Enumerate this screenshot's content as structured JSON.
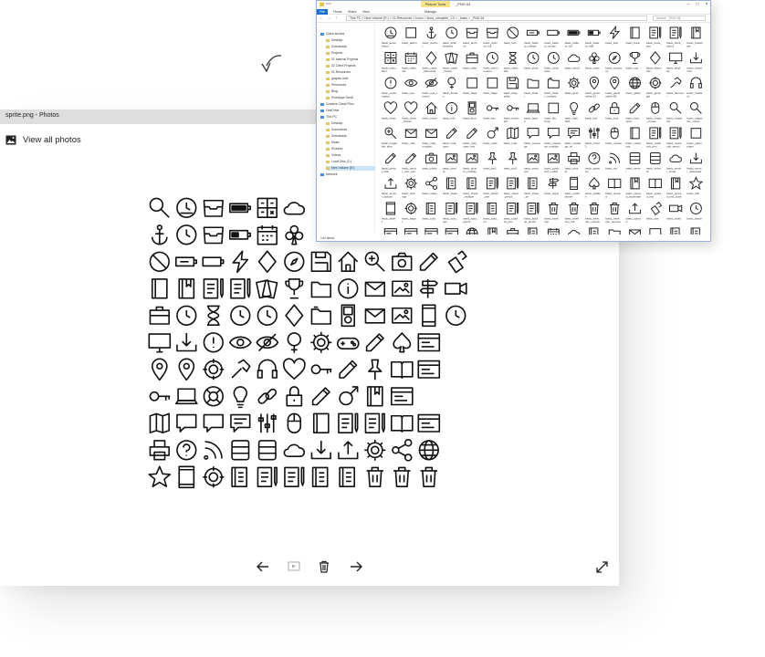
{
  "photos": {
    "title": "sprite.png - Photos",
    "view_all": "View all photos",
    "toolbar": {
      "prev": "arrow-left-icon",
      "slideshow": "slideshow-icon",
      "delete": "trash-icon",
      "next": "arrow-right-icon",
      "fullscreen": "fullscreen-icon"
    }
  },
  "explorer": {
    "title": "_PNG 64",
    "context_tab": "Picture Tools",
    "ribbon_tabs": [
      "File",
      "Home",
      "Share",
      "View",
      "Manage"
    ],
    "address": "This PC  >  New Volume (E:)  >  01 Resources  >  Icons  >  linea_complete_1.0  >  _basic  >  _PNG 64",
    "search_placeholder": "Search _PNG 64",
    "status": "144 items",
    "nav": [
      {
        "label": "Quick access",
        "level": 0
      },
      {
        "label": "Desktop",
        "level": 1
      },
      {
        "label": "Downloads",
        "level": 1
      },
      {
        "label": "Projects",
        "level": 1
      },
      {
        "label": "01 Internal Projects",
        "level": 1
      },
      {
        "label": "02 Client Projects",
        "level": 1
      },
      {
        "label": "01 Resources",
        "level": 1
      },
      {
        "label": "graphic river",
        "level": 1
      },
      {
        "label": "Resources",
        "level": 1
      },
      {
        "label": "Blog",
        "level": 1
      },
      {
        "label": "Prototype Scroll",
        "level": 1
      },
      {
        "label": "Creative Cloud Files",
        "level": 0
      },
      {
        "label": "OneDrive",
        "level": 0
      },
      {
        "label": "This PC",
        "level": 0
      },
      {
        "label": "Desktop",
        "level": 1
      },
      {
        "label": "Documents",
        "level": 1
      },
      {
        "label": "Downloads",
        "level": 1
      },
      {
        "label": "Music",
        "level": 1
      },
      {
        "label": "Pictures",
        "level": 1
      },
      {
        "label": "Videos",
        "level": 1
      },
      {
        "label": "Local Disk (C:)",
        "level": 1
      },
      {
        "label": "New Volume (E:)",
        "level": 1
      },
      {
        "label": "Network",
        "level": 0
      }
    ],
    "files": [
      "basic_accelerator",
      "basic_alarm",
      "basic_anchor",
      "basic_anticlockwise",
      "basic_archive",
      "basic_archive_full",
      "basic_ban",
      "basic_battery_charge",
      "basic_battery_empty",
      "basic_battery_full",
      "basic_battery_half",
      "basic_bolt",
      "basic_book",
      "basic_book_pen",
      "basic_book_pencil",
      "basic_bookmark",
      "basic_calculator",
      "basic_calendar",
      "basic_cards_diamonds",
      "basic_cards_hearts",
      "basic_case",
      "basic_chronometer",
      "basic_clessidre",
      "basic_clock",
      "basic_clockwise",
      "basic_cloud",
      "basic_clubs",
      "basic_compass",
      "basic_cup",
      "basic_diamonds",
      "basic_display",
      "basic_download",
      "basic_exclamation",
      "basic_eye",
      "basic_eye_closed",
      "basic_female",
      "basic_flag1",
      "basic_flag2",
      "basic_floppydisk",
      "basic_folder",
      "basic_folder_multiple",
      "basic_gear",
      "basic_geolocalize-01",
      "basic_geolocalize-05",
      "basic_globe",
      "basic_gunsight",
      "basic_hammer",
      "basic_headset",
      "basic_heart",
      "basic_heart_broken",
      "basic_home",
      "basic_info",
      "basic_ipod",
      "basic_key",
      "basic_keyboard",
      "basic_laptop",
      "basic_life_buoy",
      "basic_lightbulb",
      "basic_link",
      "basic_lock",
      "basic_lock_open",
      "basic_magic_mouse",
      "basic_magnifier",
      "basic_magnifier_minus",
      "basic_magnifier_plus",
      "basic_mail",
      "basic_mail_multiple",
      "basic_mail_open",
      "basic_mail_open_text",
      "basic_male",
      "basic_map",
      "basic_message",
      "basic_message_multiple",
      "basic_message_txt",
      "basic_mixer2",
      "basic_mouse",
      "basic_notebook",
      "basic_notebook_pen",
      "basic_notebook_pencil",
      "basic_paperplane",
      "basic_pencil_ruler",
      "basic_pencil_ruler_pen",
      "basic_photo",
      "basic_picture",
      "basic_picture_multiple",
      "basic_pin1",
      "basic_pin2",
      "basic_postcard",
      "basic_postcard_multiple",
      "basic_printer",
      "basic_question",
      "basic_rss",
      "basic_server",
      "basic_server2",
      "basic_server_cloud",
      "basic_server_download",
      "basic_server_upload",
      "basic_settings",
      "basic_share",
      "basic_sheet",
      "basic_sheet_multiple",
      "basic_sheet_pen",
      "basic_sheet_pencil",
      "basic_sheet_txt",
      "basic_signs",
      "basic_smartphone",
      "basic_spades",
      "basic_spread",
      "basic_spread_bookmark",
      "basic_spread_text",
      "basic_spread_text_bookmark",
      "basic_star",
      "basic_tablet",
      "basic_target",
      "basic_todo",
      "basic_todo_pen",
      "basic_todo_pencil",
      "basic_todo_txt",
      "basic_todolist_pen",
      "basic_todolist_pencil",
      "basic_trashcan",
      "basic_trashcan_full",
      "basic_trashcan_refresh",
      "basic_trashcan_remove",
      "basic_upload",
      "basic_usb",
      "basic_video",
      "basic_watch",
      "basic_webpage",
      "basic_webpage_img_txt",
      "basic_webpage_multiple",
      "basic_webpage_txt",
      "basic_world",
      "basic_elaboration_bookmark",
      "basic_elaboration_briefcase",
      "basic_elaboration_browser",
      "basic_elaboration_calendar",
      "basic_elaboration_cloud",
      "basic_elaboration_document",
      "basic_elaboration_folder",
      "basic_elaboration_mail",
      "basic_elaboration_message",
      "basic_elaboration_printer",
      "basic_elaboration_todo"
    ]
  },
  "sprite": {
    "rows": [
      [
        "magnifier",
        "accelerator",
        "archive",
        "battery-full",
        "calculator",
        "cloud"
      ],
      [
        "anchor",
        "clock",
        "archive-full",
        "battery-half",
        "calendar",
        "clubs"
      ],
      [
        "ban",
        "battery-charge",
        "battery-empty",
        "bolt",
        "cards-diamonds",
        "compass",
        "floppydisk",
        "home",
        "magnifier-plus",
        "photo",
        "pencil",
        "usb"
      ],
      [
        "book",
        "bookmark",
        "book-pen",
        "book-pencil",
        "cards-hearts",
        "cup",
        "folder",
        "info",
        "mail",
        "postcard",
        "signs",
        "video"
      ],
      [
        "case",
        "chronometer",
        "clessidre",
        "anticlockwise",
        "clockwise",
        "diamonds",
        "folder-multiple",
        "ipod",
        "mail-multiple",
        "picture",
        "smartphone",
        "watch"
      ],
      [
        "display",
        "download",
        "exclamation",
        "eye",
        "eye-closed",
        "female",
        "gear",
        "joystick",
        "mail-open",
        "spades",
        "webpage"
      ],
      [
        "geolocalize",
        "map-pin",
        "gunsight",
        "hammer",
        "headset",
        "heart",
        "key",
        "mail-open-text",
        "pin",
        "spread",
        "webpage-img"
      ],
      [
        "keyboard",
        "laptop",
        "life-buoy",
        "lightbulb",
        "link",
        "lock",
        "lock-open",
        "male",
        "spread-bookmark",
        "webpage-multiple"
      ],
      [
        "map",
        "message",
        "message-multiple",
        "message-txt",
        "mixer",
        "mouse",
        "notebook",
        "notebook-pen",
        "notebook-pencil",
        "spread-text",
        "webpage-txt"
      ],
      [
        "printer",
        "question",
        "rss",
        "server",
        "server2",
        "server-cloud",
        "server-download",
        "server-upload",
        "settings",
        "share",
        "world"
      ],
      [
        "star",
        "tablet",
        "target",
        "todo",
        "todo-pen",
        "todo-pencil",
        "todo-txt",
        "todolist",
        "trashcan",
        "trashcan-full",
        "trashcan-refresh"
      ]
    ]
  },
  "colors": {
    "titlebar": "#dedede",
    "explorer_border": "#9ab2cf",
    "folder": "#e8c45c",
    "file_tab": "#1c6fcd",
    "context_tab": "#f6e48a",
    "selection": "#cce4f7"
  },
  "decor": {
    "curved_arrow": "curved-arrow-icon"
  }
}
